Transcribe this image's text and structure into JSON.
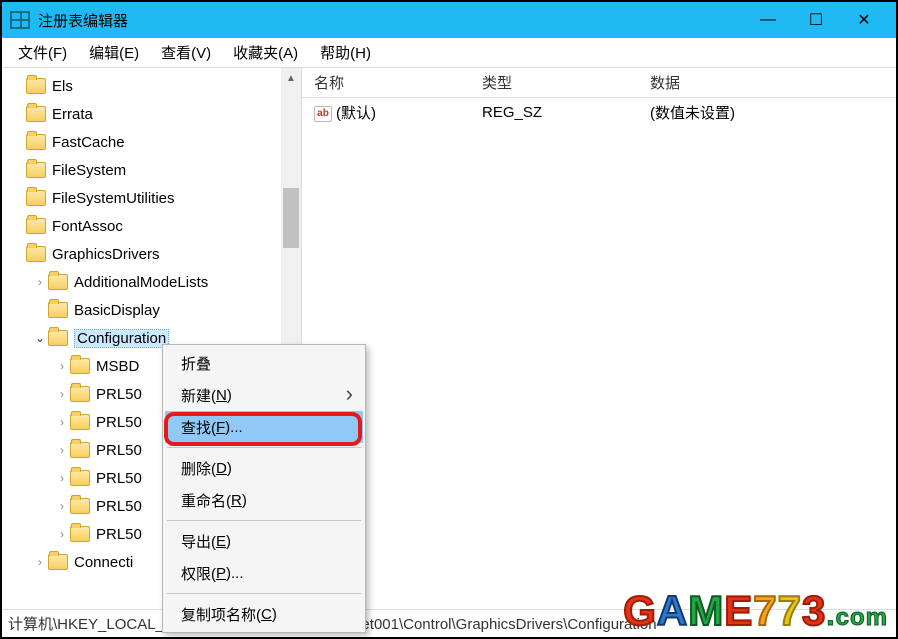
{
  "title": "注册表编辑器",
  "menubar": {
    "file": "文件(F)",
    "edit": "编辑(E)",
    "view": "查看(V)",
    "favorites": "收藏夹(A)",
    "help": "帮助(H)"
  },
  "tree": {
    "nodes": [
      {
        "label": "Els",
        "indent": 0,
        "arrow": ""
      },
      {
        "label": "Errata",
        "indent": 0,
        "arrow": ""
      },
      {
        "label": "FastCache",
        "indent": 0,
        "arrow": ""
      },
      {
        "label": "FileSystem",
        "indent": 0,
        "arrow": ""
      },
      {
        "label": "FileSystemUtilities",
        "indent": 0,
        "arrow": ""
      },
      {
        "label": "FontAssoc",
        "indent": 0,
        "arrow": ""
      },
      {
        "label": "GraphicsDrivers",
        "indent": 0,
        "arrow": ""
      },
      {
        "label": "AdditionalModeLists",
        "indent": 1,
        "arrow": ">"
      },
      {
        "label": "BasicDisplay",
        "indent": 1,
        "arrow": ""
      },
      {
        "label": "Configuration",
        "indent": 1,
        "arrow": "v",
        "selected": true
      },
      {
        "label": "MSBD",
        "indent": 2,
        "arrow": ">"
      },
      {
        "label": "PRL50",
        "indent": 2,
        "arrow": ">"
      },
      {
        "label": "PRL50",
        "indent": 2,
        "arrow": ">"
      },
      {
        "label": "PRL50",
        "indent": 2,
        "arrow": ">"
      },
      {
        "label": "PRL50",
        "indent": 2,
        "arrow": ">"
      },
      {
        "label": "PRL50",
        "indent": 2,
        "arrow": ">"
      },
      {
        "label": "PRL50",
        "indent": 2,
        "arrow": ">"
      },
      {
        "label": "Connecti",
        "indent": 1,
        "arrow": ">"
      }
    ]
  },
  "list": {
    "headers": {
      "name": "名称",
      "type": "类型",
      "data": "数据"
    },
    "rows": [
      {
        "name": "(默认)",
        "type": "REG_SZ",
        "data": "(数值未设置)"
      }
    ]
  },
  "context_menu": {
    "collapse": "折叠",
    "new_pre": "新建(",
    "new_ul": "N",
    "new_post": ")",
    "find_pre": "查找(",
    "find_ul": "F",
    "find_post": ")...",
    "delete_pre": "删除(",
    "delete_ul": "D",
    "delete_post": ")",
    "rename_pre": "重命名(",
    "rename_ul": "R",
    "rename_post": ")",
    "export_pre": "导出(",
    "export_ul": "E",
    "export_post": ")",
    "perm_pre": "权限(",
    "perm_ul": "P",
    "perm_post": ")...",
    "copykey_pre": "复制项名称(",
    "copykey_ul": "C",
    "copykey_post": ")"
  },
  "statusbar": "计算机\\HKEY_LOCAL_MACHINE\\SYSTEM\\ControlSet001\\Control\\GraphicsDrivers\\Configuration",
  "watermark": {
    "g": "G",
    "a": "A",
    "m": "M",
    "e": "E",
    "n7": "7",
    "n72": "7",
    "n3": "3",
    "dot": ".",
    "com": "com"
  }
}
